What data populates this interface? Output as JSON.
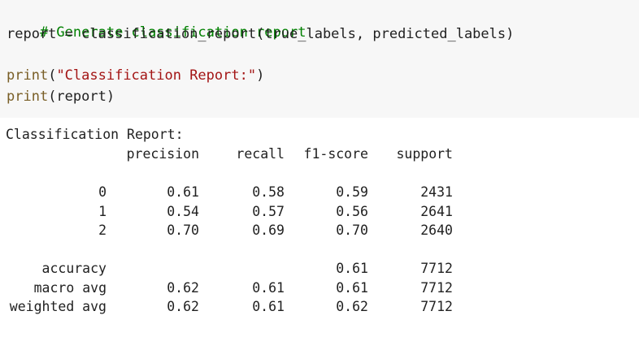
{
  "code": {
    "comment": "# Generate classification report",
    "assign_target": "report",
    "assign_op": " = ",
    "assign_call": "classification_report(true_labels, predicted_labels)",
    "print1_fn": "print",
    "print1_open": "(",
    "print1_string": "\"Classification Report:\"",
    "print1_close": ")",
    "print2_fn": "print",
    "print2_args": "(report)"
  },
  "output": {
    "title": "Classification Report:",
    "headers": [
      "precision",
      "recall",
      "f1-score",
      "support"
    ],
    "class_rows": [
      {
        "label": "0",
        "precision": "0.61",
        "recall": "0.58",
        "f1": "0.59",
        "support": "2431"
      },
      {
        "label": "1",
        "precision": "0.54",
        "recall": "0.57",
        "f1": "0.56",
        "support": "2641"
      },
      {
        "label": "2",
        "precision": "0.70",
        "recall": "0.69",
        "f1": "0.70",
        "support": "2640"
      }
    ],
    "summary_rows": [
      {
        "label": "accuracy",
        "precision": "",
        "recall": "",
        "f1": "0.61",
        "support": "7712"
      },
      {
        "label": "macro avg",
        "precision": "0.62",
        "recall": "0.61",
        "f1": "0.61",
        "support": "7712"
      },
      {
        "label": "weighted avg",
        "precision": "0.62",
        "recall": "0.61",
        "f1": "0.62",
        "support": "7712"
      }
    ]
  }
}
